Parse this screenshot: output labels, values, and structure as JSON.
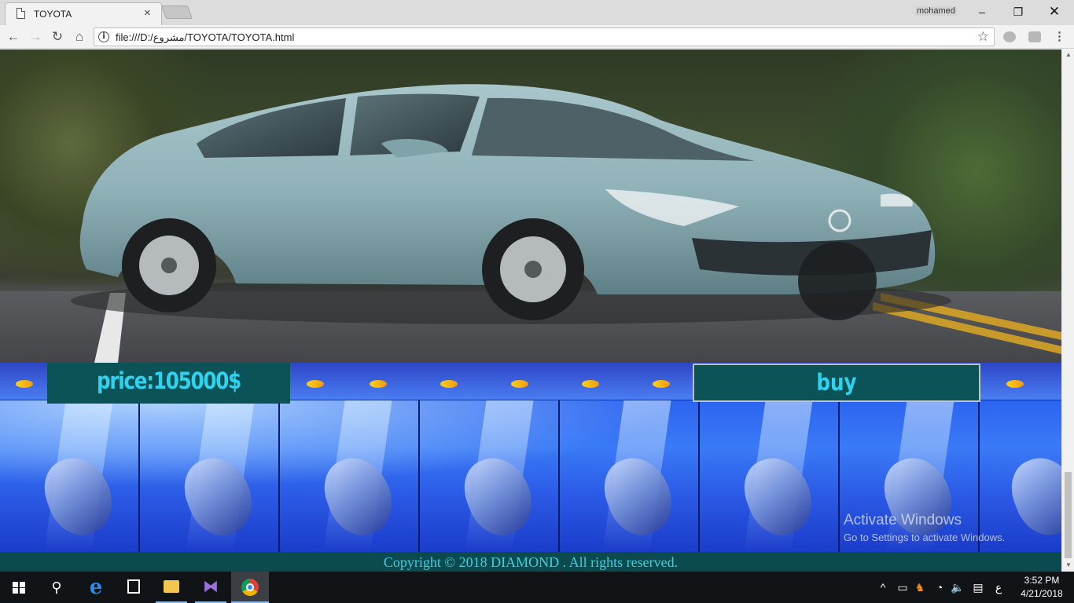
{
  "browser": {
    "tab_title": "TOYOTA",
    "tab_close": "×",
    "profile_name": "mohamed",
    "window_minimize": "–",
    "window_maximize": "❐",
    "window_close": "✕",
    "nav_back": "←",
    "nav_forward": "→",
    "nav_reload": "↻",
    "nav_home": "⌂",
    "url": "file:///D:/مشروع/TOYOTA/TOYOTA.html",
    "info_icon": "i",
    "bookmark_star": "☆",
    "menu": "⋮"
  },
  "page": {
    "price_label": "price:105000$",
    "buy_label": "buy",
    "footer": "Copyright © 2018 DIAMOND . All rights reserved."
  },
  "watermark": {
    "title": "Activate Windows",
    "subtitle": "Go to Settings to activate Windows."
  },
  "scrollbar": {
    "up": "▲",
    "down": "▼"
  },
  "taskbar": {
    "search_icon": "⚲",
    "edge_icon": "e",
    "vs_icon": "⧓",
    "tray_chevron": "^",
    "tray_network": "▭",
    "tray_fox": "♞",
    "tray_wifi": "◔",
    "tray_volume": "🔈",
    "tray_messages": "▤",
    "language": "ع",
    "time": "3:52 PM",
    "date": "4/21/2018"
  },
  "icons": [
    "page-icon",
    "info-icon",
    "star-icon",
    "windows-logo-icon",
    "search-icon",
    "edge-icon",
    "store-icon",
    "file-explorer-icon",
    "visual-studio-icon",
    "chrome-icon"
  ]
}
